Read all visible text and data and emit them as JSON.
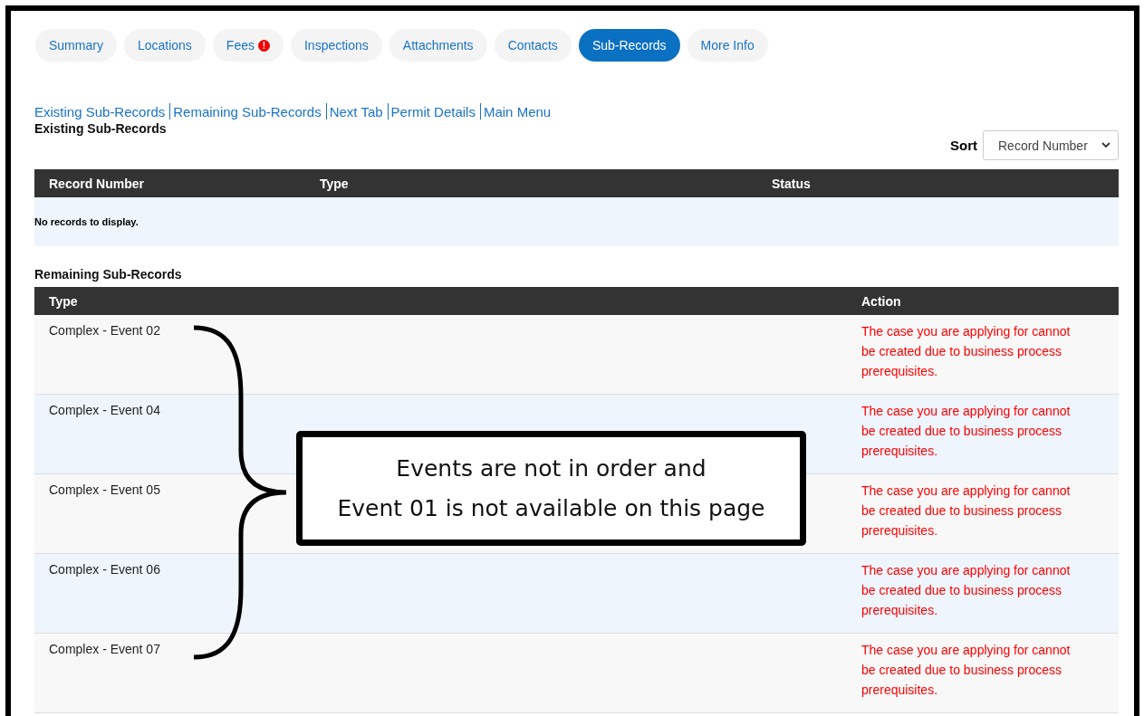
{
  "tabs": [
    {
      "label": "Summary",
      "selected": false,
      "alert": false
    },
    {
      "label": "Locations",
      "selected": false,
      "alert": false
    },
    {
      "label": "Fees",
      "selected": false,
      "alert": true,
      "alert_mark": "!"
    },
    {
      "label": "Inspections",
      "selected": false,
      "alert": false
    },
    {
      "label": "Attachments",
      "selected": false,
      "alert": false
    },
    {
      "label": "Contacts",
      "selected": false,
      "alert": false
    },
    {
      "label": "Sub-Records",
      "selected": true,
      "alert": false
    },
    {
      "label": "More Info",
      "selected": false,
      "alert": false
    }
  ],
  "links": [
    "Existing Sub-Records",
    "Remaining Sub-Records",
    "Next Tab",
    "Permit Details",
    "Main Menu"
  ],
  "existing": {
    "heading": "Existing Sub-Records",
    "sort_label": "Sort",
    "sort_value": "Record Number",
    "columns": [
      "Record Number",
      "Type",
      "Status"
    ],
    "empty_message": "No records to display."
  },
  "remaining": {
    "heading": "Remaining Sub-Records",
    "columns": [
      "Type",
      "Action"
    ],
    "rows": [
      {
        "type": "Complex - Event 02",
        "action": "The case you are applying for cannot be created due to business process prerequisites."
      },
      {
        "type": "Complex - Event 04",
        "action": "The case you are applying for cannot be created due to business process prerequisites."
      },
      {
        "type": "Complex - Event 05",
        "action": "The case you are applying for cannot be created due to business process prerequisites."
      },
      {
        "type": "Complex - Event 06",
        "action": "The case you are applying for cannot be created due to business process prerequisites."
      },
      {
        "type": "Complex - Event 07",
        "action": "The case you are applying for cannot be created due to business process prerequisites."
      }
    ]
  },
  "annotation": {
    "lines": [
      "Events are not in order and",
      "Event 01 is not available on this page"
    ]
  }
}
